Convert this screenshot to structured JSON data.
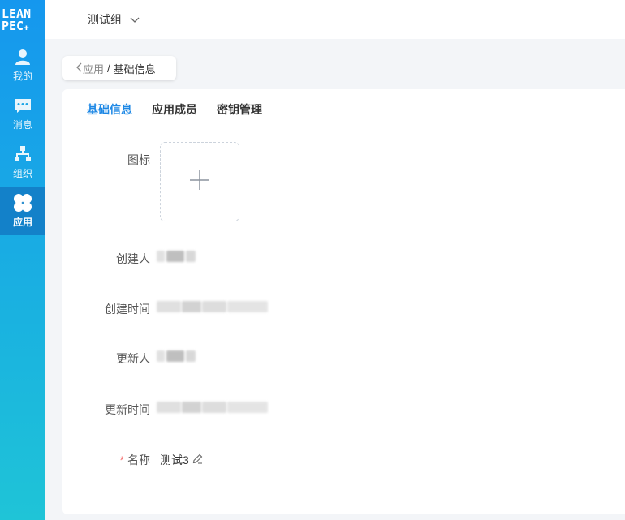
{
  "sidebar": {
    "logo_line1": "LEAN",
    "logo_line2": "PEC",
    "items": [
      {
        "label": "我的",
        "icon": "user-icon"
      },
      {
        "label": "消息",
        "icon": "message-icon"
      },
      {
        "label": "组织",
        "icon": "org-icon"
      },
      {
        "label": "应用",
        "icon": "apps-icon",
        "active": true
      }
    ]
  },
  "topbar": {
    "group": "测试组"
  },
  "breadcrumb": {
    "parent": "应用",
    "separator": "/",
    "current": "基础信息"
  },
  "tabs": [
    {
      "label": "基础信息",
      "active": true
    },
    {
      "label": "应用成员"
    },
    {
      "label": "密钥管理"
    }
  ],
  "form": {
    "icon_label": "图标",
    "creator_label": "创建人",
    "created_time_label": "创建时间",
    "updater_label": "更新人",
    "updated_time_label": "更新时间",
    "name_label": "名称",
    "required_mark": "*",
    "name_value": "测试3"
  },
  "colors": {
    "accent": "#1e88e5",
    "sidebar_top": "#1597ee",
    "sidebar_bottom": "#1fc4d7",
    "required": "#f56c6c"
  }
}
